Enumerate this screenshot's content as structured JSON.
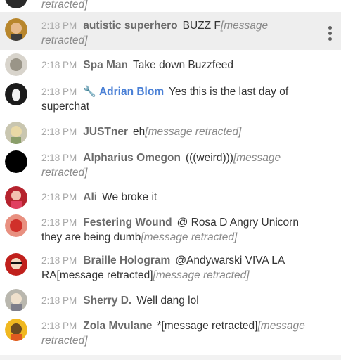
{
  "messages": [
    {
      "time": "",
      "author": "",
      "text": "",
      "retracted_text": "retracted]"
    },
    {
      "time": "2:18 PM",
      "author": "autistic superhero",
      "text": "BUZZ F",
      "retracted_text": "[message retracted]"
    },
    {
      "time": "2:18 PM",
      "author": "Spa Man",
      "text": "Take down Buzzfeed",
      "retracted_text": ""
    },
    {
      "time": "2:18 PM",
      "author": "Adrian Blom",
      "text": "Yes this is the last day of superchat",
      "retracted_text": "",
      "moderator_icon": "wrench-icon"
    },
    {
      "time": "2:18 PM",
      "author": "JUSTner",
      "text": "eh",
      "retracted_text": "[message retracted]"
    },
    {
      "time": "2:18 PM",
      "author": "Alpharius Omegon",
      "text": "(((weird)))",
      "retracted_text": "[message retracted]"
    },
    {
      "time": "2:18 PM",
      "author": "Ali",
      "text": "We broke it",
      "retracted_text": ""
    },
    {
      "time": "2:18 PM",
      "author": "Festering Wound",
      "text": "@ Rosa D Angry Unicorn they are being dumb",
      "retracted_text": "[message retracted]"
    },
    {
      "time": "2:18 PM",
      "author": "Braille Hologram",
      "text": "@Andywarski VIVA LA RA[message retracted]",
      "retracted_text": "[message retracted]"
    },
    {
      "time": "2:18 PM",
      "author": "Sherry D.",
      "text": "Well dang lol",
      "retracted_text": ""
    },
    {
      "time": "2:18 PM",
      "author": "Zola Mvulane",
      "text": "*[message retracted]",
      "retracted_text": "[message retracted]"
    }
  ],
  "colors": {
    "moderator": "#4a80d6",
    "author": "#6b6b6b",
    "timestamp": "#a8a8a8",
    "highlight": "#eeeeee"
  },
  "menu_icon": "more-vert-icon"
}
